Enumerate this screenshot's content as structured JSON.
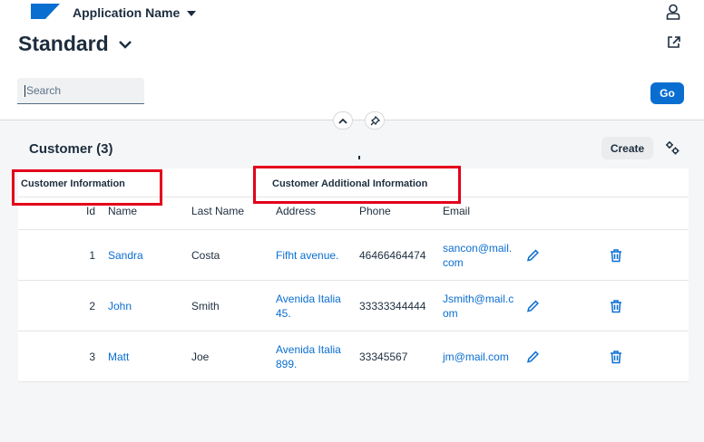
{
  "shell": {
    "app_title": "Application Name"
  },
  "header": {
    "variant": "Standard",
    "search_placeholder": "Search",
    "go_label": "Go"
  },
  "section": {
    "title": "Customer (3)",
    "create_label": "Create"
  },
  "table": {
    "groups": [
      "Customer Information",
      "Customer Additional Information"
    ],
    "columns": [
      "Id",
      "Name",
      "Last Name",
      "Address",
      "Phone",
      "Email"
    ],
    "rows": [
      {
        "id": "1",
        "name": "Sandra",
        "last": "Costa",
        "address": "Fifht avenue.",
        "phone": "46466464474",
        "email": "sancon@mail.com"
      },
      {
        "id": "2",
        "name": "John",
        "last": "Smith",
        "address": "Avenida Italia 45.",
        "phone": "33333344444",
        "email": "Jsmith@mail.com"
      },
      {
        "id": "3",
        "name": "Matt",
        "last": "Joe",
        "address": "Avenida Italia 899.",
        "phone": "33345567",
        "email": "jm@mail.com"
      }
    ]
  },
  "icons": {
    "logo": "sap-logo",
    "user": "user-icon",
    "share": "share-icon",
    "collapse": "chevron-up-icon",
    "pin": "pin-icon",
    "settings": "settings-icon",
    "edit": "edit-icon",
    "delete": "delete-icon"
  },
  "colors": {
    "accent": "#0a6ed1",
    "highlight": "#e3001b"
  }
}
